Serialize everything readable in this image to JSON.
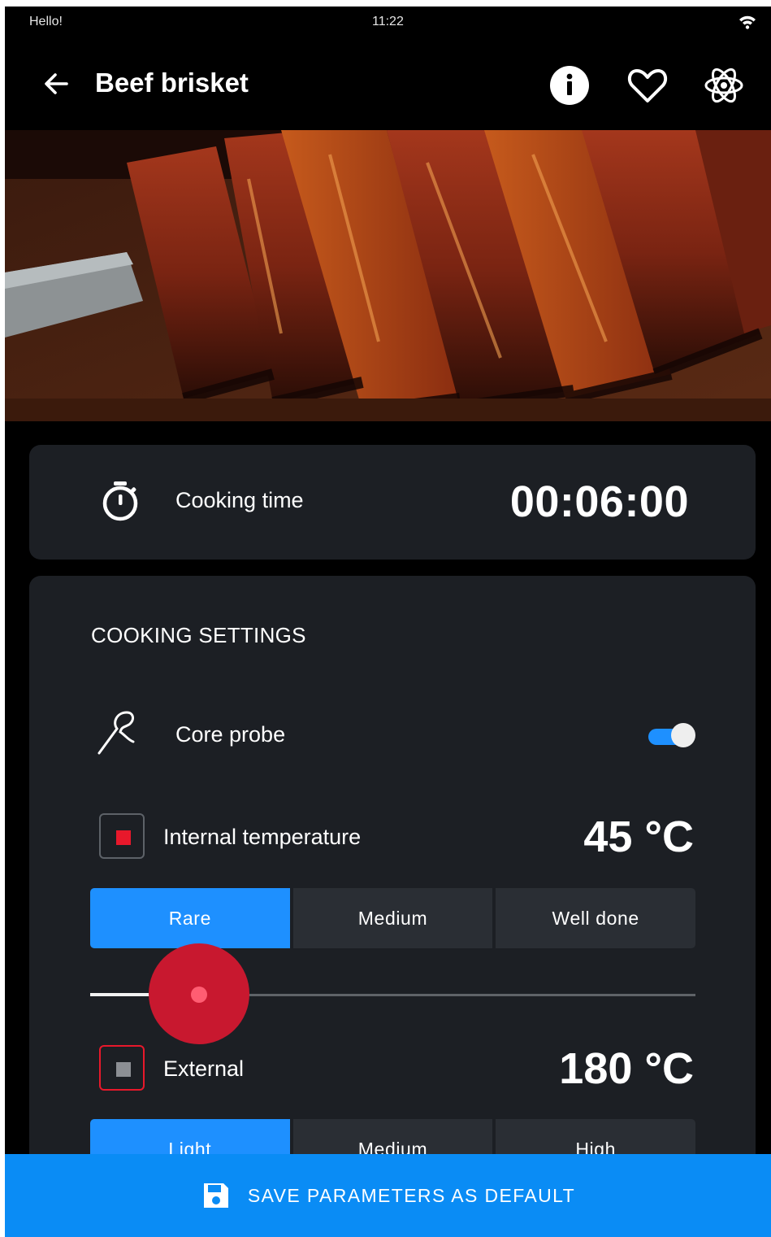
{
  "status_bar": {
    "greeting": "Hello!",
    "time": "11:22",
    "wifi_icon": "wifi-icon"
  },
  "app_bar": {
    "title": "Beef brisket",
    "back_icon": "back-arrow-icon",
    "info_icon": "info-icon",
    "favorite_icon": "heart-icon",
    "settings_icon": "atom-icon"
  },
  "hero": {
    "subject": "beef-brisket-photo"
  },
  "timer": {
    "label": "Cooking time",
    "value": "00:06:00",
    "icon": "stopwatch-icon"
  },
  "settings": {
    "title": "COOKING SETTINGS",
    "core_probe": {
      "label": "Core probe",
      "enabled": true,
      "icon": "probe-icon"
    },
    "internal": {
      "label": "Internal temperature",
      "value": "45 °C",
      "checked": true,
      "doneness_options": [
        "Rare",
        "Medium",
        "Well done"
      ],
      "selected": "Rare",
      "slider_fraction": 0.18
    },
    "external": {
      "label": "External",
      "value": "180 °C",
      "checked": false,
      "intensity_options": [
        "Light",
        "Medium",
        "High"
      ],
      "selected": "Light"
    }
  },
  "save_button": {
    "label": "SAVE PARAMETERS AS DEFAULT",
    "icon": "save-icon"
  },
  "colors": {
    "accent": "#1e90ff",
    "danger": "#e8182b",
    "card": "#1c1f24",
    "background": "#000000"
  }
}
